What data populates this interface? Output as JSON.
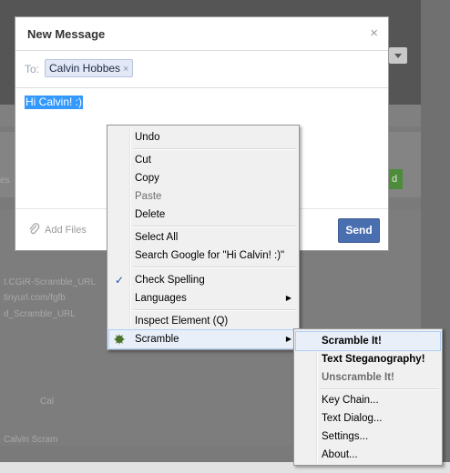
{
  "dialog": {
    "title": "New Message",
    "close_glyph": "×",
    "to_label": "To:",
    "recipient": "Calvin Hobbes",
    "recipient_remove": "×",
    "message": "Hi Calvin! :)",
    "add_files": "Add Files",
    "send": "Send"
  },
  "context_menu": {
    "undo": "Undo",
    "cut": "Cut",
    "copy": "Copy",
    "paste": "Paste",
    "delete": "Delete",
    "select_all": "Select All",
    "search_google": "Search Google for \"Hi Calvin! :)\"",
    "check_spelling": "Check Spelling",
    "check_spelling_checked": true,
    "languages": "Languages",
    "inspect_element": "Inspect Element (Q)",
    "scramble": "Scramble"
  },
  "scramble_submenu": {
    "scramble_it": "Scramble It!",
    "text_steganography": "Text Steganography!",
    "unscramble_it": "Unscramble It!",
    "key_chain": "Key Chain...",
    "text_dialog": "Text Dialog...",
    "settings": "Settings...",
    "about": "About..."
  },
  "icons": {
    "close": "close-icon",
    "remove_token": "remove-token-icon",
    "attach": "paperclip-icon",
    "checkmark": "checkmark-icon",
    "scramble_addon": "scramble-addon-icon",
    "submenu_arrow": "submenu-arrow-icon"
  },
  "colors": {
    "send_button": "#4a6fb0",
    "selection": "#3399ff",
    "menu_bg": "#f0f0f0",
    "menu_highlight": "#e8eff9"
  }
}
